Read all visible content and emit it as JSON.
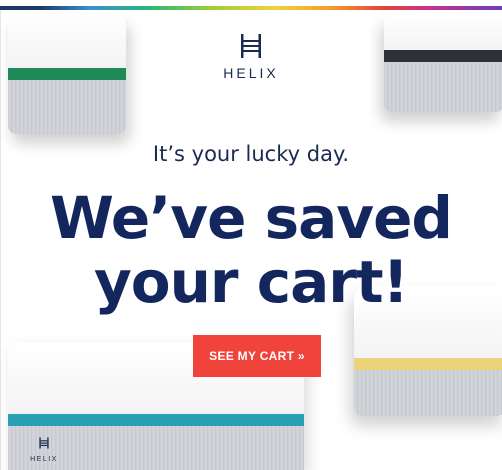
{
  "brand": {
    "name": "HELIX",
    "logo_icon": "helix-h-icon",
    "footer_name": "HELIX"
  },
  "hero": {
    "subhead": "It’s your lucky day.",
    "headline_line1": "We’ve saved",
    "headline_line2": "your cart!"
  },
  "cta": {
    "label": "SEE MY CART »",
    "color": "#f0433b"
  },
  "colors": {
    "navy": "#13275e",
    "band_green": "#1e8a57",
    "band_black": "#2f3136",
    "band_yellow": "#ecd27a",
    "band_teal": "#27a1b3"
  }
}
